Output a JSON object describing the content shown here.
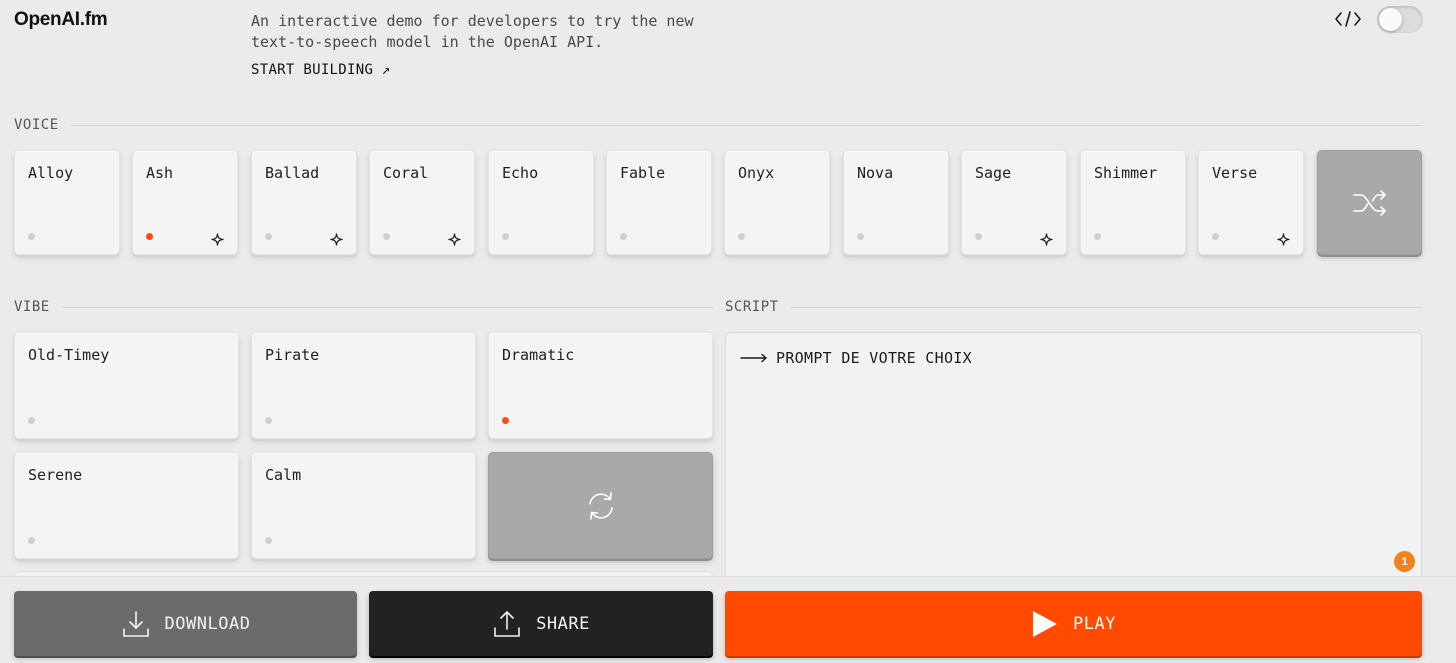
{
  "header": {
    "logo": "OpenAI.fm",
    "tagline": "An interactive demo for developers to try the new text-to-speech model in the OpenAI API.",
    "start_building": "START BUILDING ↗",
    "dev_mode_on": false
  },
  "voice": {
    "label": "VOICE",
    "items": [
      {
        "name": "Alloy",
        "selected": false,
        "sparkle": false
      },
      {
        "name": "Ash",
        "selected": true,
        "sparkle": true
      },
      {
        "name": "Ballad",
        "selected": false,
        "sparkle": true
      },
      {
        "name": "Coral",
        "selected": false,
        "sparkle": true
      },
      {
        "name": "Echo",
        "selected": false,
        "sparkle": false
      },
      {
        "name": "Fable",
        "selected": false,
        "sparkle": false
      },
      {
        "name": "Onyx",
        "selected": false,
        "sparkle": false
      },
      {
        "name": "Nova",
        "selected": false,
        "sparkle": false
      },
      {
        "name": "Sage",
        "selected": false,
        "sparkle": true
      },
      {
        "name": "Shimmer",
        "selected": false,
        "sparkle": false
      },
      {
        "name": "Verse",
        "selected": false,
        "sparkle": true
      }
    ]
  },
  "vibe": {
    "label": "VIBE",
    "items": [
      {
        "name": "Old-Timey",
        "selected": false
      },
      {
        "name": "Pirate",
        "selected": false
      },
      {
        "name": "Dramatic",
        "selected": true
      },
      {
        "name": "Serene",
        "selected": false
      },
      {
        "name": "Calm",
        "selected": false
      }
    ]
  },
  "script": {
    "label": "SCRIPT",
    "text": "PROMPT DE VOTRE CHOIX",
    "badge": "1"
  },
  "actions": {
    "download": "DOWNLOAD",
    "share": "SHARE",
    "play": "PLAY"
  },
  "colors": {
    "accent": "#ff4a00",
    "selected_dot": "#ff4a0f",
    "badge": "#f0831c"
  }
}
